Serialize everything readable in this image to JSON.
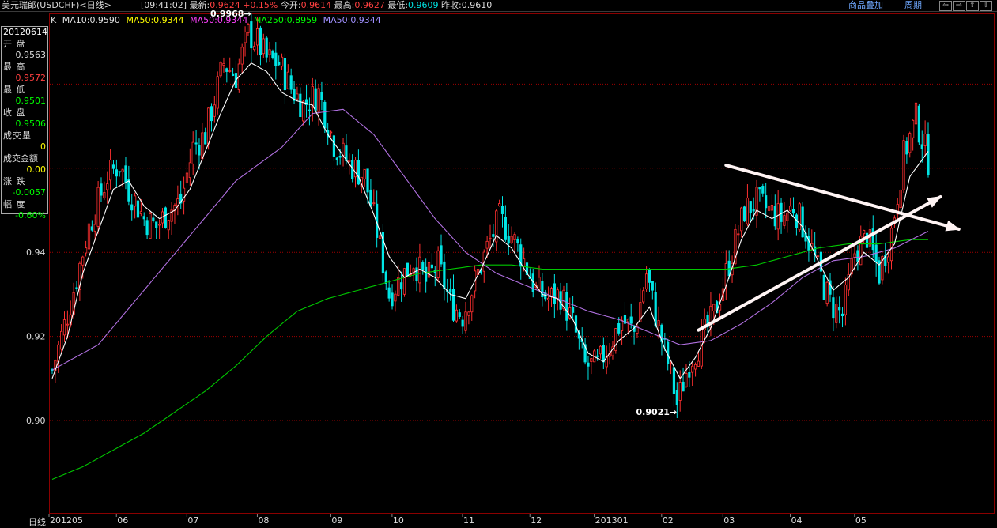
{
  "topbar": {
    "title": "美元瑞郎(USDCHF)<日线>",
    "time": "[09:41:02]",
    "last_label": "最新:",
    "last_value": "0.9624",
    "change": "+0.15%",
    "open_label": "今开:",
    "open_value": "0.9614",
    "high_label": "最高:",
    "high_value": "0.9627",
    "low_label": "最低:",
    "low_value": "0.9609",
    "prevclose_label": "昨收:",
    "prevclose_value": "0.9610",
    "overlay_button": "商品叠加",
    "period_button": "周期",
    "nav": [
      "⇦",
      "⇨",
      "⇧",
      "⇩"
    ]
  },
  "ma_legend": {
    "k": "K",
    "ma10": "MA10:0.9590",
    "ma50a": "MA50:0.9344",
    "ma50b": "MA50:0.9344",
    "ma250": "MA250:0.8959",
    "ma50c": "MA50:0.9344"
  },
  "info_panel": {
    "date": "20120614",
    "open_label": "开  盘",
    "open": "0.9563",
    "high_label": "最  高",
    "high": "0.9572",
    "low_label": "最  低",
    "low": "0.9501",
    "close_label": "收  盘",
    "close": "0.9506",
    "volume_label": "成交量",
    "volume": "0",
    "amount_label": "成交金额",
    "amount": "0.00",
    "change_label": "涨  跌",
    "change": "-0.0057",
    "pct_label": "幅  度",
    "pct": "-0.60%"
  },
  "bottom_label": "日线",
  "colors": {
    "up": "#ff3030",
    "down": "#00e5e5",
    "ma10": "#ffffff",
    "ma50": "#b070e0",
    "ma250": "#00c800",
    "grid": "#a00000",
    "arrow": "#fff4f4",
    "ma_legend_ma10": "#e0e0e0",
    "ma_legend_ma50a": "#ffff00",
    "ma_legend_ma50b": "#ff40ff",
    "ma_legend_ma250": "#00ff00",
    "ma_legend_ma50c": "#a090ff"
  },
  "chart_data": {
    "type": "candlestick",
    "ylim": [
      0.8782,
      0.9968
    ],
    "y_ticks": [
      {
        "value": 0.9,
        "label": "0.90"
      },
      {
        "value": 0.92,
        "label": "0.92"
      },
      {
        "value": 0.94,
        "label": "0.94"
      },
      {
        "value": 0.96,
        "label": ""
      },
      {
        "value": 0.98,
        "label": ""
      }
    ],
    "x_axis_labels": [
      {
        "label": "201205",
        "x": 0
      },
      {
        "label": "06",
        "x": 22
      },
      {
        "label": "07",
        "x": 45
      },
      {
        "label": "08",
        "x": 68
      },
      {
        "label": "09",
        "x": 92
      },
      {
        "label": "10",
        "x": 112
      },
      {
        "label": "11",
        "x": 135
      },
      {
        "label": "12",
        "x": 157
      },
      {
        "label": "201301",
        "x": 178
      },
      {
        "label": "02",
        "x": 200
      },
      {
        "label": "03",
        "x": 220
      },
      {
        "label": "04",
        "x": 242
      },
      {
        "label": "05",
        "x": 263
      }
    ],
    "bars_count": 287,
    "close_path": [
      [
        0,
        0.912
      ],
      [
        6,
        0.928
      ],
      [
        12,
        0.946
      ],
      [
        18,
        0.958
      ],
      [
        22,
        0.961
      ],
      [
        25,
        0.955
      ],
      [
        30,
        0.948
      ],
      [
        34,
        0.946
      ],
      [
        38,
        0.95
      ],
      [
        42,
        0.952
      ],
      [
        46,
        0.965
      ],
      [
        50,
        0.968
      ],
      [
        56,
        0.985
      ],
      [
        60,
        0.982
      ],
      [
        64,
        0.992
      ],
      [
        67,
        0.99
      ],
      [
        70,
        0.986
      ],
      [
        74,
        0.985
      ],
      [
        78,
        0.979
      ],
      [
        82,
        0.975
      ],
      [
        87,
        0.978
      ],
      [
        92,
        0.966
      ],
      [
        97,
        0.961
      ],
      [
        102,
        0.958
      ],
      [
        106,
        0.945
      ],
      [
        110,
        0.93
      ],
      [
        114,
        0.934
      ],
      [
        118,
        0.938
      ],
      [
        122,
        0.933
      ],
      [
        126,
        0.937
      ],
      [
        130,
        0.928
      ],
      [
        134,
        0.925
      ],
      [
        138,
        0.933
      ],
      [
        142,
        0.941
      ],
      [
        146,
        0.948
      ],
      [
        150,
        0.944
      ],
      [
        154,
        0.938
      ],
      [
        158,
        0.931
      ],
      [
        162,
        0.929
      ],
      [
        166,
        0.93
      ],
      [
        170,
        0.923
      ],
      [
        174,
        0.913
      ],
      [
        178,
        0.913
      ],
      [
        182,
        0.918
      ],
      [
        186,
        0.924
      ],
      [
        190,
        0.921
      ],
      [
        194,
        0.935
      ],
      [
        198,
        0.922
      ],
      [
        202,
        0.911
      ],
      [
        204,
        0.904
      ],
      [
        208,
        0.914
      ],
      [
        212,
        0.919
      ],
      [
        216,
        0.925
      ],
      [
        220,
        0.935
      ],
      [
        226,
        0.95
      ],
      [
        230,
        0.952
      ],
      [
        234,
        0.95
      ],
      [
        238,
        0.948
      ],
      [
        242,
        0.951
      ],
      [
        246,
        0.945
      ],
      [
        250,
        0.936
      ],
      [
        254,
        0.928
      ],
      [
        258,
        0.925
      ],
      [
        262,
        0.94
      ],
      [
        266,
        0.944
      ],
      [
        270,
        0.935
      ],
      [
        274,
        0.945
      ],
      [
        278,
        0.963
      ],
      [
        282,
        0.972
      ],
      [
        286,
        0.962
      ]
    ],
    "ma10_path": [
      [
        0,
        0.91
      ],
      [
        5,
        0.92
      ],
      [
        10,
        0.935
      ],
      [
        15,
        0.945
      ],
      [
        20,
        0.955
      ],
      [
        25,
        0.957
      ],
      [
        30,
        0.951
      ],
      [
        35,
        0.948
      ],
      [
        40,
        0.95
      ],
      [
        45,
        0.955
      ],
      [
        50,
        0.964
      ],
      [
        55,
        0.973
      ],
      [
        60,
        0.981
      ],
      [
        65,
        0.985
      ],
      [
        70,
        0.983
      ],
      [
        75,
        0.978
      ],
      [
        80,
        0.976
      ],
      [
        85,
        0.975
      ],
      [
        90,
        0.968
      ],
      [
        95,
        0.963
      ],
      [
        100,
        0.958
      ],
      [
        105,
        0.949
      ],
      [
        110,
        0.939
      ],
      [
        115,
        0.934
      ],
      [
        120,
        0.936
      ],
      [
        125,
        0.934
      ],
      [
        130,
        0.93
      ],
      [
        135,
        0.929
      ],
      [
        140,
        0.936
      ],
      [
        145,
        0.944
      ],
      [
        150,
        0.941
      ],
      [
        155,
        0.935
      ],
      [
        160,
        0.93
      ],
      [
        165,
        0.929
      ],
      [
        170,
        0.924
      ],
      [
        175,
        0.916
      ],
      [
        180,
        0.914
      ],
      [
        185,
        0.919
      ],
      [
        190,
        0.922
      ],
      [
        195,
        0.927
      ],
      [
        200,
        0.917
      ],
      [
        205,
        0.91
      ],
      [
        210,
        0.915
      ],
      [
        215,
        0.922
      ],
      [
        220,
        0.932
      ],
      [
        225,
        0.943
      ],
      [
        230,
        0.95
      ],
      [
        235,
        0.948
      ],
      [
        240,
        0.95
      ],
      [
        245,
        0.946
      ],
      [
        250,
        0.938
      ],
      [
        255,
        0.931
      ],
      [
        260,
        0.934
      ],
      [
        265,
        0.94
      ],
      [
        270,
        0.937
      ],
      [
        275,
        0.942
      ],
      [
        280,
        0.958
      ],
      [
        286,
        0.964
      ]
    ],
    "ma50_path": [
      [
        0,
        0.912
      ],
      [
        15,
        0.918
      ],
      [
        30,
        0.931
      ],
      [
        45,
        0.944
      ],
      [
        60,
        0.957
      ],
      [
        75,
        0.965
      ],
      [
        85,
        0.973
      ],
      [
        95,
        0.974
      ],
      [
        105,
        0.968
      ],
      [
        115,
        0.958
      ],
      [
        125,
        0.948
      ],
      [
        135,
        0.94
      ],
      [
        145,
        0.935
      ],
      [
        155,
        0.932
      ],
      [
        165,
        0.929
      ],
      [
        175,
        0.926
      ],
      [
        185,
        0.924
      ],
      [
        195,
        0.921
      ],
      [
        205,
        0.918
      ],
      [
        215,
        0.919
      ],
      [
        225,
        0.923
      ],
      [
        235,
        0.928
      ],
      [
        245,
        0.934
      ],
      [
        255,
        0.938
      ],
      [
        265,
        0.939
      ],
      [
        275,
        0.941
      ],
      [
        286,
        0.945
      ]
    ],
    "ma250_path": [
      [
        0,
        0.886
      ],
      [
        10,
        0.889
      ],
      [
        20,
        0.893
      ],
      [
        30,
        0.897
      ],
      [
        40,
        0.902
      ],
      [
        50,
        0.907
      ],
      [
        60,
        0.913
      ],
      [
        70,
        0.92
      ],
      [
        80,
        0.926
      ],
      [
        90,
        0.929
      ],
      [
        100,
        0.931
      ],
      [
        110,
        0.933
      ],
      [
        120,
        0.935
      ],
      [
        130,
        0.936
      ],
      [
        140,
        0.937
      ],
      [
        150,
        0.937
      ],
      [
        160,
        0.936
      ],
      [
        170,
        0.936
      ],
      [
        180,
        0.936
      ],
      [
        190,
        0.936
      ],
      [
        200,
        0.936
      ],
      [
        210,
        0.936
      ],
      [
        220,
        0.936
      ],
      [
        230,
        0.937
      ],
      [
        240,
        0.939
      ],
      [
        250,
        0.941
      ],
      [
        260,
        0.942
      ],
      [
        270,
        0.942
      ],
      [
        280,
        0.943
      ],
      [
        286,
        0.943
      ]
    ],
    "annotations": [
      {
        "text": "0.9968",
        "bar": 66,
        "value": 0.9968,
        "kind": "high"
      },
      {
        "text": "0.9021",
        "bar": 205,
        "value": 0.9021,
        "kind": "low"
      }
    ],
    "trendlines": [
      {
        "from": {
          "bar": 211,
          "value": 0.9215
        },
        "to": {
          "bar": 290,
          "value": 0.9532
        },
        "kind": "support-arrow"
      },
      {
        "from": {
          "bar": 220,
          "value": 0.9607
        },
        "to": {
          "bar": 296,
          "value": 0.9455
        },
        "kind": "resistance-arrow"
      }
    ],
    "grid": true,
    "legend": "top-left"
  }
}
